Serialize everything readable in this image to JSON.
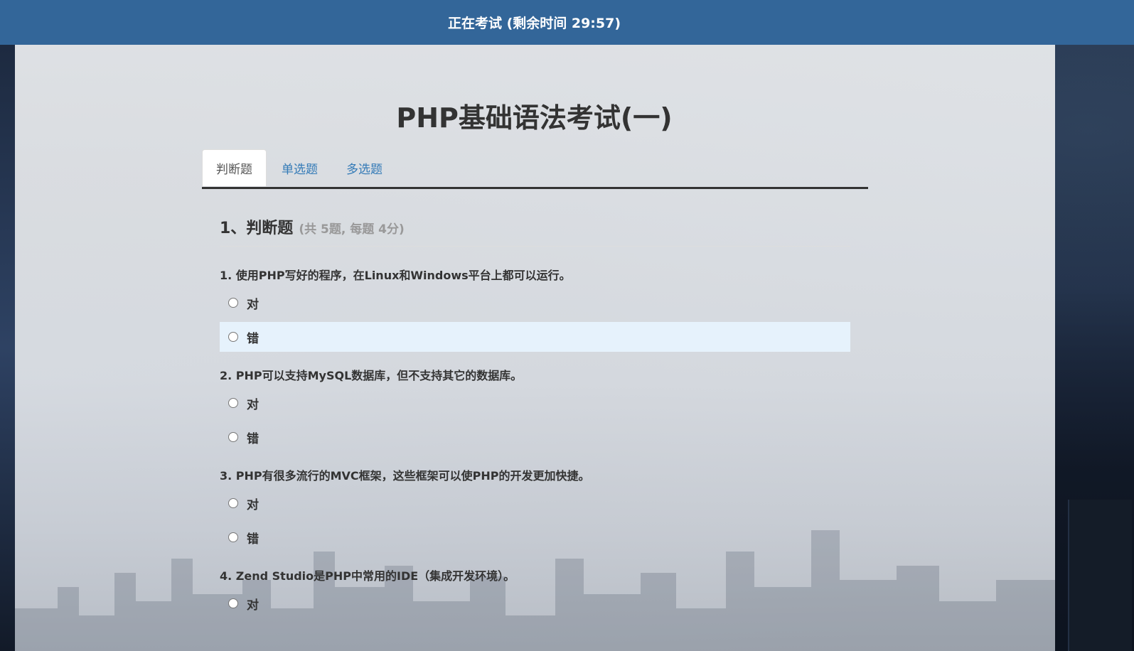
{
  "topbar": {
    "status": "正在考试 (剩余时间 29:57)"
  },
  "exam": {
    "title": "PHP基础语法考试(一)"
  },
  "tabs": [
    {
      "label": "判断题",
      "active": true
    },
    {
      "label": "单选题",
      "active": false
    },
    {
      "label": "多选题",
      "active": false
    }
  ],
  "section": {
    "title": "1、判断题",
    "meta": "(共 5题, 每题 4分)"
  },
  "questions": [
    {
      "text": "1. 使用PHP写好的程序，在Linux和Windows平台上都可以运行。",
      "options": [
        "对",
        "错"
      ]
    },
    {
      "text": "2. PHP可以支持MySQL数据库，但不支持其它的数据库。",
      "options": [
        "对",
        "错"
      ]
    },
    {
      "text": "3. PHP有很多流行的MVC框架，这些框架可以使PHP的开发更加快捷。",
      "options": [
        "对",
        "错"
      ]
    },
    {
      "text": "4. Zend Studio是PHP中常用的IDE（集成开发环境）。",
      "options": [
        "对"
      ]
    }
  ],
  "colors": {
    "topbar": "#336699",
    "tab_link": "#337ab7",
    "option_hover": "#e6f2fc"
  }
}
